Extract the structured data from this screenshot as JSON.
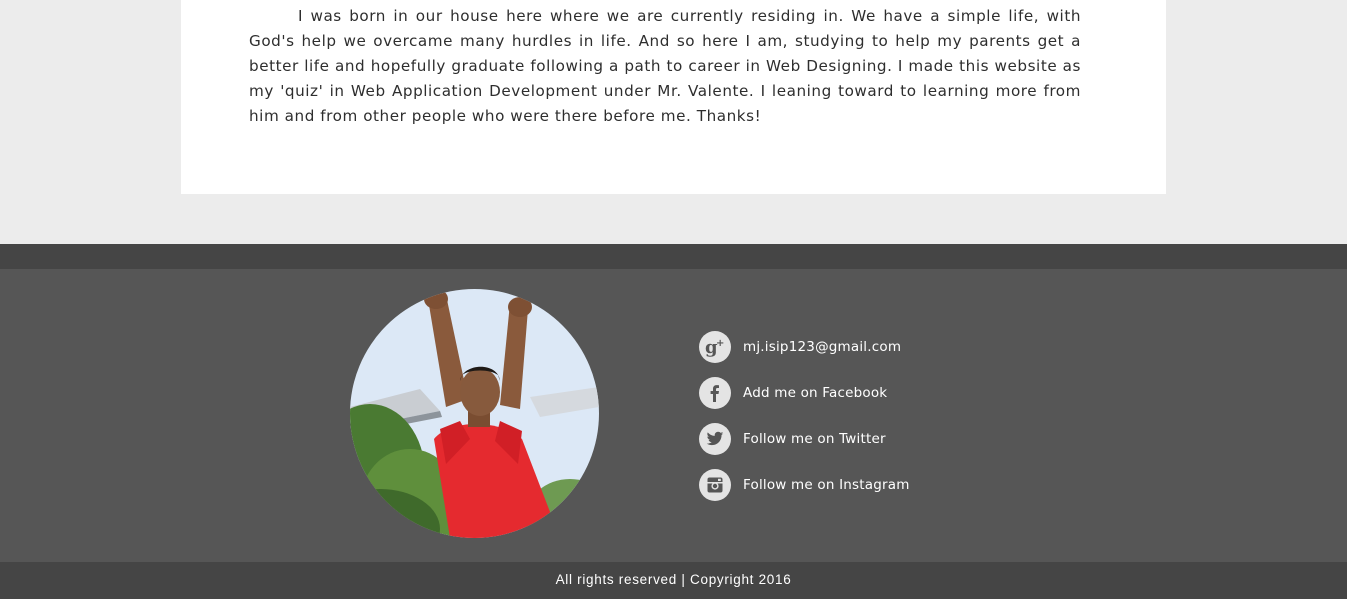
{
  "about": {
    "paragraph": "I was born in our house here where we are currently residing in. We have a simple life, with God's help we overcame many hurdles in life. And so here I am, studying to help my parents get a better life and hopefully graduate following a path to career in Web Designing. I made this website as my 'quiz' in Web Application Development under Mr. Valente. I leaning toward to learning more from him and from other people who were there before me. Thanks!"
  },
  "footer": {
    "contacts": [
      {
        "icon": "google-plus-icon",
        "label": "mj.isip123@gmail.com"
      },
      {
        "icon": "facebook-icon",
        "label": "Add me on Facebook"
      },
      {
        "icon": "twitter-icon",
        "label": "Follow me on Twitter"
      },
      {
        "icon": "instagram-icon",
        "label": "Follow me on Instagram"
      }
    ],
    "copyright": "All rights reserved | Copyright 2016"
  },
  "colors": {
    "page_background": "#ececec",
    "card_background": "#ffffff",
    "footer_dark": "#454545",
    "footer_main": "#565656",
    "icon_circle": "#e4e4e4",
    "icon_glyph": "#565656"
  }
}
